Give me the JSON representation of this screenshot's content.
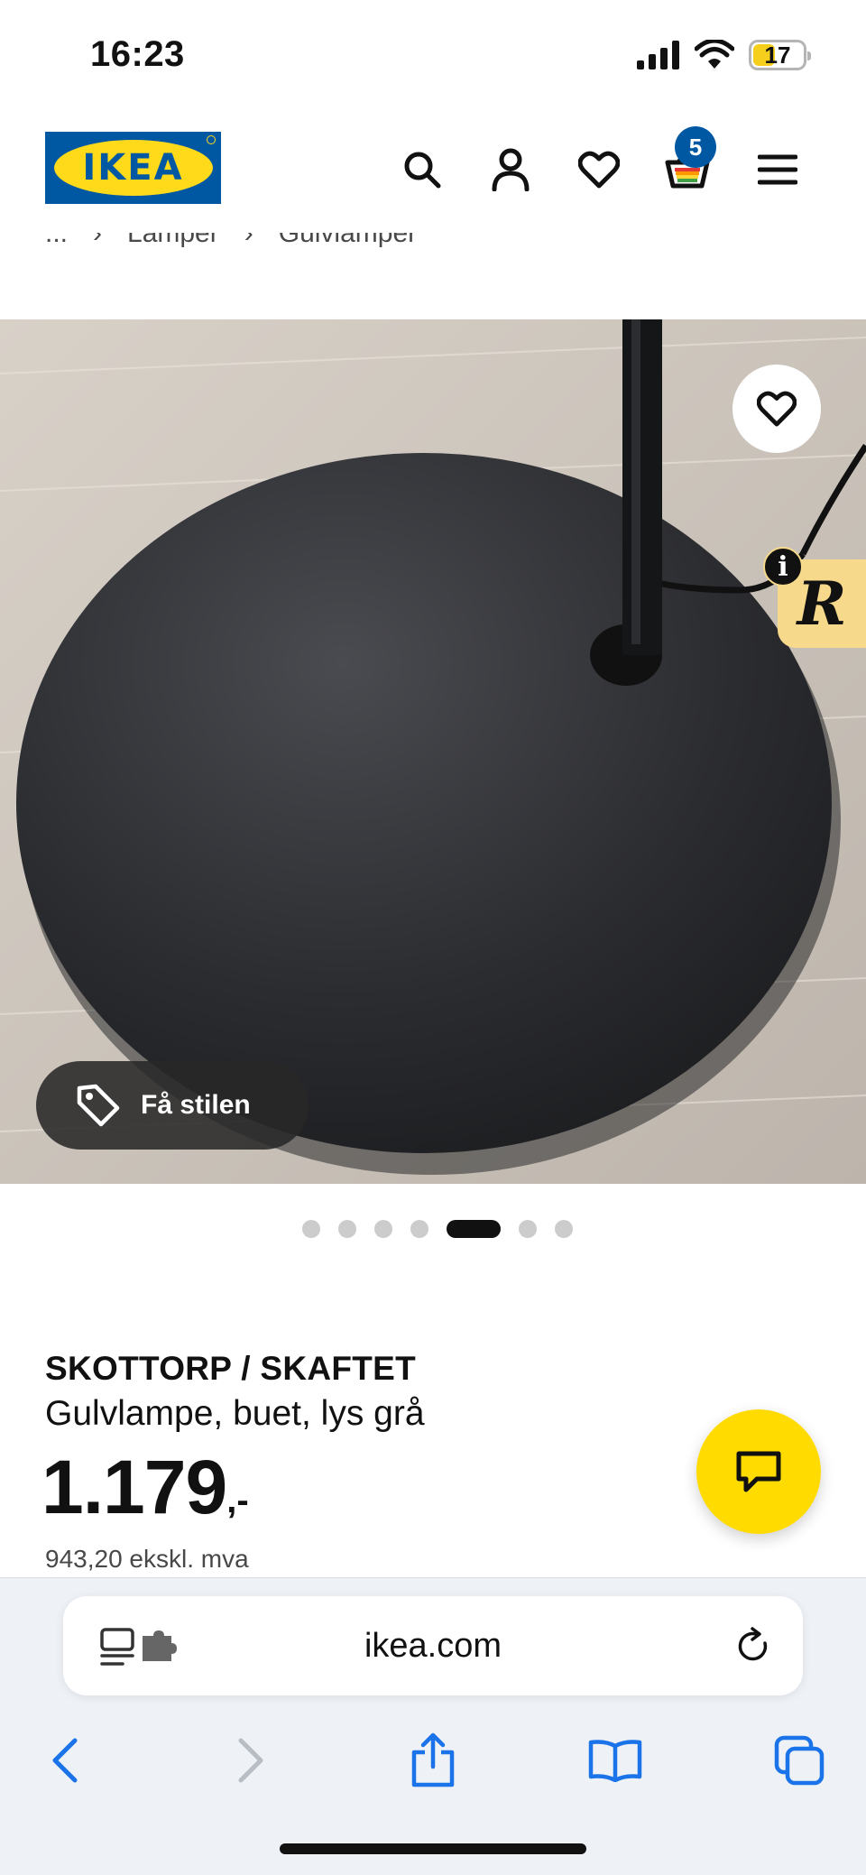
{
  "status_bar": {
    "time": "16:23",
    "battery": "17",
    "icons": [
      "cellular-signal-icon",
      "wifi-icon",
      "battery-icon"
    ]
  },
  "header": {
    "logo_text": "IKEA",
    "cart_count": "5",
    "icons": [
      "search-icon",
      "account-icon",
      "heart-icon",
      "cart-icon",
      "menu-icon"
    ]
  },
  "breadcrumb": {
    "items": [
      "...",
      "Lamper",
      "Gulvlamper"
    ],
    "separator": "›"
  },
  "gallery": {
    "style_button_label": "Få stilen",
    "info_label": "i",
    "widget_letter": "R",
    "total_images": 7,
    "active_index": 5
  },
  "product": {
    "name": "SKOTTORP / SKAFTET",
    "description": "Gulvlampe, buet, lys grå",
    "price": "1.179",
    "price_suffix": ",-",
    "price_ex_vat": "943,20 ekskl. mva"
  },
  "browser": {
    "url": "ikea.com",
    "icons": [
      "reader-icon",
      "extension-icon",
      "reload-icon",
      "back-icon",
      "forward-icon",
      "share-icon",
      "bookmarks-icon",
      "tabs-icon"
    ]
  },
  "colors": {
    "ikea_blue": "#0058a3",
    "ikea_yellow": "#ffda1a",
    "chat_yellow": "#ffdb00",
    "safari_blue": "#1a73e8"
  }
}
